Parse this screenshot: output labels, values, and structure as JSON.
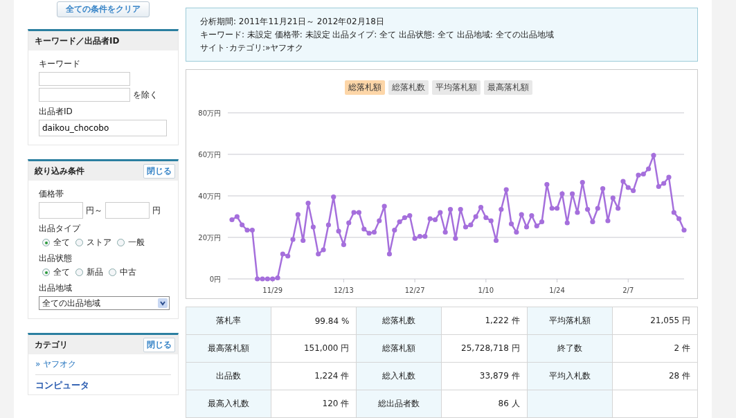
{
  "clear_button": "全ての条件をクリア",
  "keyword_panel": {
    "title": "キーワード／出品者ID",
    "keyword_label": "キーワード",
    "exclude_label": "を除く",
    "seller_label": "出品者ID",
    "seller_value": "daikou_chocobo"
  },
  "filter_panel": {
    "title": "絞り込み条件",
    "close": "閉じる",
    "price_label": "価格帯",
    "price_from_unit": "円～",
    "price_to_unit": "円",
    "groups": [
      {
        "label": "出品タイプ",
        "options": [
          {
            "label": "全て",
            "selected": true
          },
          {
            "label": "ストア",
            "selected": false
          },
          {
            "label": "一般",
            "selected": false
          }
        ]
      },
      {
        "label": "出品状態",
        "options": [
          {
            "label": "全て",
            "selected": true
          },
          {
            "label": "新品",
            "selected": false
          },
          {
            "label": "中古",
            "selected": false
          }
        ]
      }
    ],
    "region_label": "出品地域",
    "region_value": "全ての出品地域"
  },
  "category_panel": {
    "title": "カテゴリ",
    "close": "閉じる",
    "current": "» ヤフオク",
    "items": [
      "コンピュータ"
    ]
  },
  "info": {
    "lines": [
      "分析期間: 2011年11月21日～ 2012年02月18日",
      "キーワード: 未設定 価格帯: 未設定 出品タイプ: 全て 出品状態: 全て 出品地域: 全ての出品地域",
      "サイト･カテゴリ:»ヤフオク"
    ]
  },
  "chart_tabs": [
    {
      "label": "総落札額",
      "selected": true
    },
    {
      "label": "総落札数",
      "selected": false
    },
    {
      "label": "平均落札額",
      "selected": false
    },
    {
      "label": "最高落札額",
      "selected": false
    }
  ],
  "chart_data": {
    "type": "line",
    "grid": true,
    "categories": [
      null,
      null,
      null,
      null,
      null,
      null,
      null,
      null,
      "11/29",
      null,
      null,
      null,
      null,
      null,
      null,
      null,
      null,
      null,
      null,
      null,
      null,
      null,
      "12/13",
      null,
      null,
      null,
      null,
      null,
      null,
      null,
      null,
      null,
      null,
      null,
      null,
      null,
      "12/27",
      null,
      null,
      null,
      null,
      null,
      null,
      null,
      null,
      null,
      null,
      null,
      null,
      null,
      "1/10",
      null,
      null,
      null,
      null,
      null,
      null,
      null,
      null,
      null,
      null,
      null,
      null,
      null,
      "1/24",
      null,
      null,
      null,
      null,
      null,
      null,
      null,
      null,
      null,
      null,
      null,
      null,
      null,
      "2/7",
      null,
      null,
      null,
      null,
      null,
      null,
      null,
      null,
      null,
      null,
      null
    ],
    "series": [
      {
        "color": "#a56fdc",
        "marker": "circle",
        "values": [
          28.5,
          30,
          26,
          23.5,
          23.5,
          0,
          0,
          0,
          0,
          0.5,
          12,
          11,
          19,
          31,
          18.5,
          36.5,
          25,
          12,
          14,
          26,
          39.5,
          23,
          16.5,
          27,
          32,
          32,
          24,
          22,
          22.5,
          28,
          35,
          12,
          23.5,
          27.5,
          29.5,
          30.5,
          19.5,
          20.5,
          20.5,
          29,
          28.5,
          32,
          22.5,
          33.5,
          19.5,
          33.5,
          25,
          26,
          30,
          34.5,
          29.5,
          28,
          18.5,
          33.5,
          43,
          26.5,
          22.5,
          31,
          25,
          30.5,
          25.5,
          27.5,
          45.5,
          34,
          34,
          41,
          27,
          41,
          32,
          46.5,
          33.5,
          27.5,
          34,
          43.5,
          28,
          39,
          34,
          47,
          44,
          42.5,
          50,
          50.5,
          53,
          59.5,
          44.5,
          46,
          49,
          32,
          29,
          23.5
        ]
      }
    ],
    "ylim": [
      0,
      80
    ],
    "yticks": [
      {
        "value": 0,
        "label": "0円"
      },
      {
        "value": 20,
        "label": "20万円"
      },
      {
        "value": 40,
        "label": "40万円"
      },
      {
        "value": 60,
        "label": "60万円"
      },
      {
        "value": 80,
        "label": "80万円"
      }
    ]
  },
  "stats": [
    [
      {
        "label": "落札率",
        "value": "99.84 %"
      },
      {
        "label": "総落札数",
        "value": "1,222 件"
      },
      {
        "label": "平均落札額",
        "value": "21,055 円"
      }
    ],
    [
      {
        "label": "最高落札額",
        "value": "151,000 円"
      },
      {
        "label": "総落札額",
        "value": "25,728,718 円"
      },
      {
        "label": "終了数",
        "value": "2 件"
      }
    ],
    [
      {
        "label": "出品数",
        "value": "1,224 件"
      },
      {
        "label": "総入札数",
        "value": "33,879 件"
      },
      {
        "label": "平均入札数",
        "value": "28 件"
      }
    ],
    [
      {
        "label": "最高入札数",
        "value": "120 件"
      },
      {
        "label": "総出品者数",
        "value": "86 人"
      }
    ]
  ]
}
